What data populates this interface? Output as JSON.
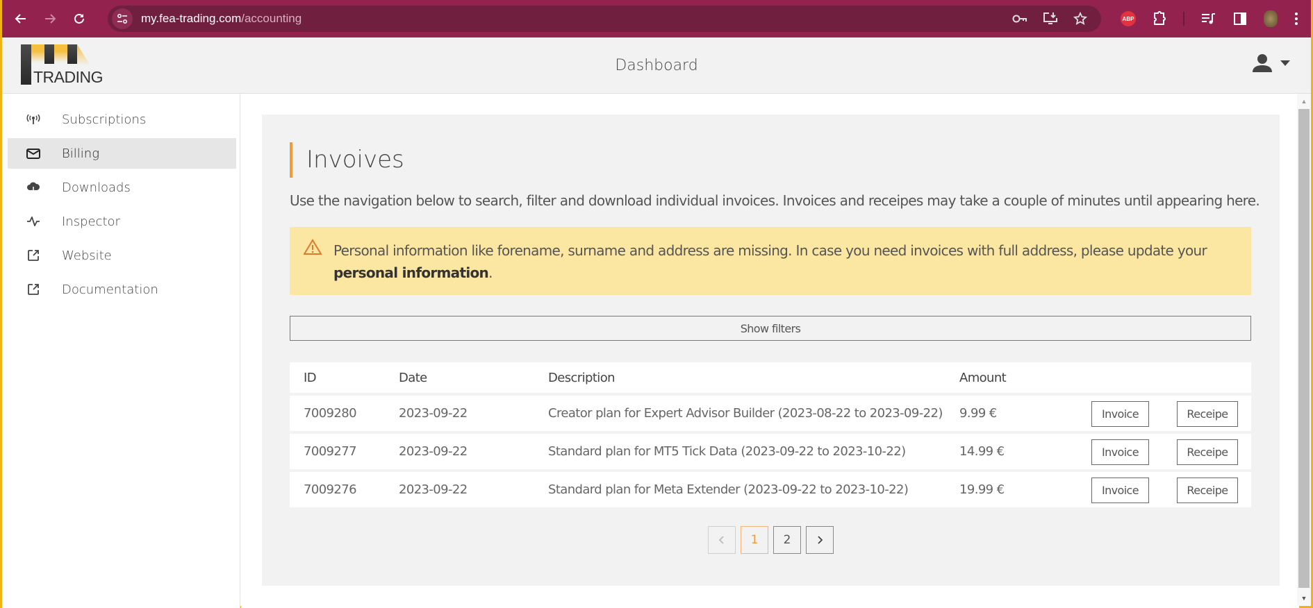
{
  "browser": {
    "url_host": "my.fea-trading.com",
    "url_path": "/accounting",
    "abp_label": "ABP"
  },
  "header": {
    "logo_text": "TRADING",
    "title": "Dashboard"
  },
  "sidebar": {
    "items": [
      {
        "label": "Subscriptions",
        "icon": "broadcast-icon",
        "active": false
      },
      {
        "label": "Billing",
        "icon": "envelope-icon",
        "active": true
      },
      {
        "label": "Downloads",
        "icon": "cloud-download-icon",
        "active": false
      },
      {
        "label": "Inspector",
        "icon": "pulse-icon",
        "active": false
      },
      {
        "label": "Website",
        "icon": "external-link-icon",
        "active": false
      },
      {
        "label": "Documentation",
        "icon": "external-link-icon",
        "active": false
      }
    ]
  },
  "main": {
    "title": "Invoives",
    "intro": "Use the navigation below to search, filter and download individual invoices. Invoices and receipes may take a couple of minutes until appearing here.",
    "alert": {
      "text": "Personal information like forename, surname and address are missing. In case you need invoices with full address, please update your ",
      "link": "personal information",
      "suffix": ".",
      "color": "#fbe6a2"
    },
    "filters_label": "Show filters",
    "table": {
      "headers": [
        "ID",
        "Date",
        "Description",
        "Amount"
      ],
      "rows": [
        {
          "id": "7009280",
          "date": "2023-09-22",
          "description": "Creator plan for Expert Advisor Builder (2023-08-22 to 2023-09-22)",
          "amount": "9.99 €",
          "invoice_label": "Invoice",
          "receipe_label": "Receipe"
        },
        {
          "id": "7009277",
          "date": "2023-09-22",
          "description": "Standard plan for MT5 Tick Data (2023-09-22 to 2023-10-22)",
          "amount": "14.99 €",
          "invoice_label": "Invoice",
          "receipe_label": "Receipe"
        },
        {
          "id": "7009276",
          "date": "2023-09-22",
          "description": "Standard plan for Meta Extender (2023-09-22 to 2023-10-22)",
          "amount": "19.99 €",
          "invoice_label": "Invoice",
          "receipe_label": "Receipe"
        }
      ]
    },
    "pagination": {
      "prev": "‹",
      "pages": [
        "1",
        "2"
      ],
      "current": "1",
      "next": "›"
    }
  },
  "colors": {
    "browser_frame": "#93234e",
    "accent": "#f29a38",
    "alert_bg": "#fbe6a2"
  }
}
